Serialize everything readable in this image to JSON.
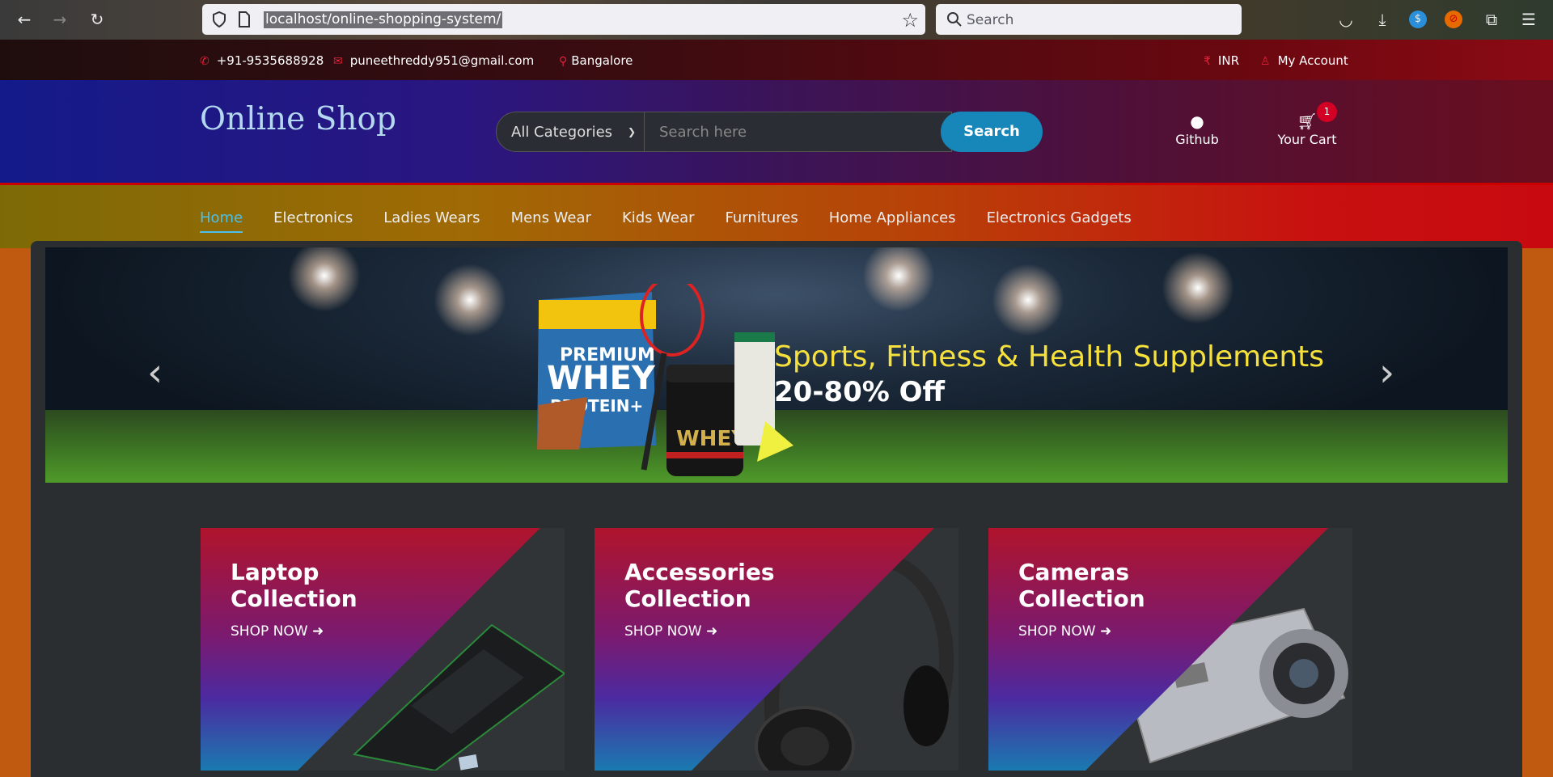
{
  "browser": {
    "url": "localhost/online-shopping-system/",
    "search_placeholder": "Search"
  },
  "top_header": {
    "phone": "+91-9535688928",
    "email": "puneethreddy951@gmail.com",
    "location": "Bangalore",
    "currency": "INR",
    "account": "My Account"
  },
  "header": {
    "logo": "Online Shop",
    "category_select": "All Categories",
    "search_placeholder": "Search here",
    "search_button": "Search",
    "github_label": "Github",
    "cart_label": "Your Cart",
    "cart_qty": "1"
  },
  "nav": {
    "items": [
      {
        "label": "Home",
        "active": true
      },
      {
        "label": "Electronics"
      },
      {
        "label": "Ladies Wears"
      },
      {
        "label": "Mens Wear"
      },
      {
        "label": "Kids Wear"
      },
      {
        "label": "Furnitures"
      },
      {
        "label": "Home Appliances"
      },
      {
        "label": "Electronics Gadgets"
      }
    ]
  },
  "banner": {
    "title": "Sports, Fitness & Health Supplements",
    "subtitle": "20-80% Off",
    "product_text_1": "PREMIUM WHEY PROTEIN+",
    "product_text_2": "WHEY"
  },
  "collections": [
    {
      "line1": "Laptop",
      "line2": "Collection",
      "cta": "SHOP NOW"
    },
    {
      "line1": "Accessories",
      "line2": "Collection",
      "cta": "SHOP NOW"
    },
    {
      "line1": "Cameras",
      "line2": "Collection",
      "cta": "SHOP NOW"
    }
  ],
  "colors": {
    "accent": "#d10024",
    "search_button": "#1687b8",
    "active_nav": "#4bc0ea",
    "banner_title": "#f6e03c"
  }
}
